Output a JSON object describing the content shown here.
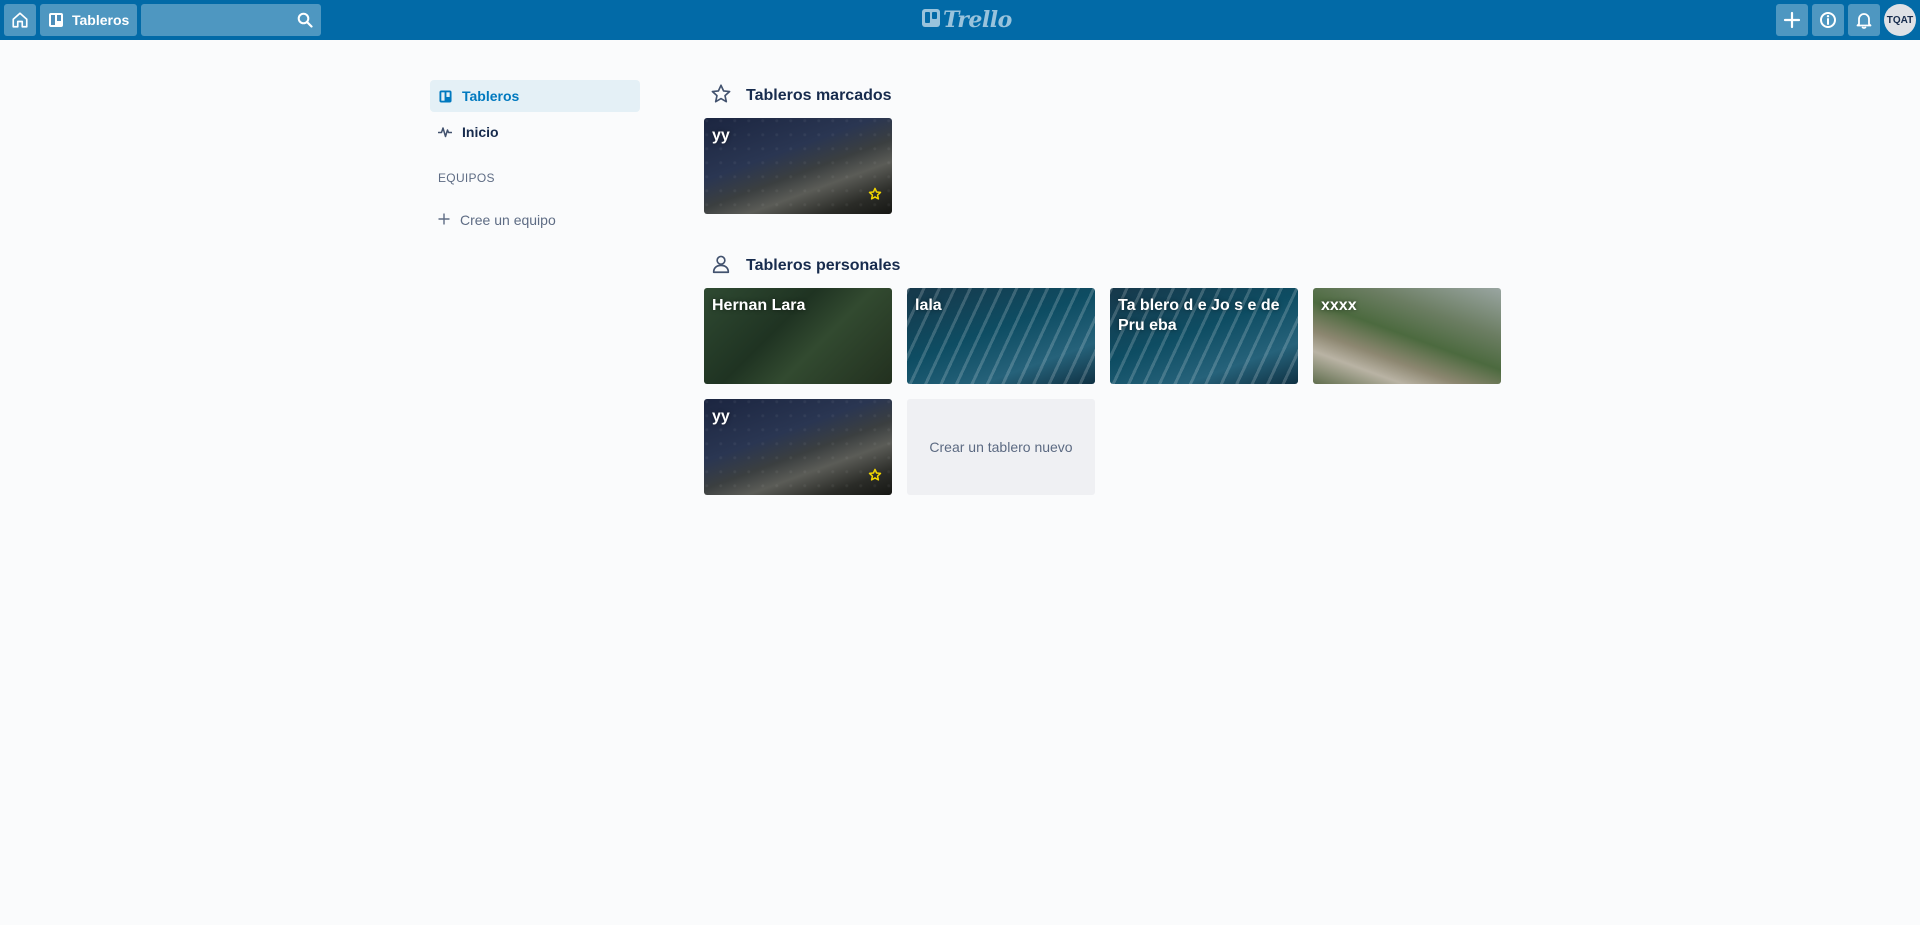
{
  "header": {
    "boards_label": "Tableros",
    "search": {
      "value": "",
      "placeholder": ""
    },
    "logo_text": "Trello",
    "avatar_initials": "TQAT",
    "icons": [
      "home-icon",
      "board-icon",
      "search-icon",
      "plus-icon",
      "info-icon",
      "bell-icon"
    ]
  },
  "sidebar": {
    "items": [
      {
        "label": "Tableros",
        "icon": "board-icon",
        "active": true
      },
      {
        "label": "Inicio",
        "icon": "activity-icon",
        "active": false
      }
    ],
    "teams_title": "EQUIPOS",
    "create_team_label": "Cree un equipo"
  },
  "main": {
    "starred": {
      "title": "Tableros marcados",
      "icon": "star-outline-icon",
      "boards": [
        {
          "name": "yy",
          "starred": true
        }
      ]
    },
    "personal": {
      "title": "Tableros personales",
      "icon": "person-icon",
      "boards": [
        {
          "name": "Hernan Lara",
          "starred": false
        },
        {
          "name": "lala",
          "starred": false
        },
        {
          "name": "Ta blero d e Jo s e de Pru eba",
          "starred": false
        },
        {
          "name": "xxxx",
          "starred": false
        },
        {
          "name": "yy",
          "starred": true
        }
      ],
      "create_label": "Crear un tablero nuevo"
    }
  },
  "colors": {
    "header_bg": "#026aa7",
    "active_nav_bg": "#e4f0f6",
    "active_nav_text": "#0079bf",
    "star": "#f2d600",
    "page_bg": "#fafbfc"
  }
}
